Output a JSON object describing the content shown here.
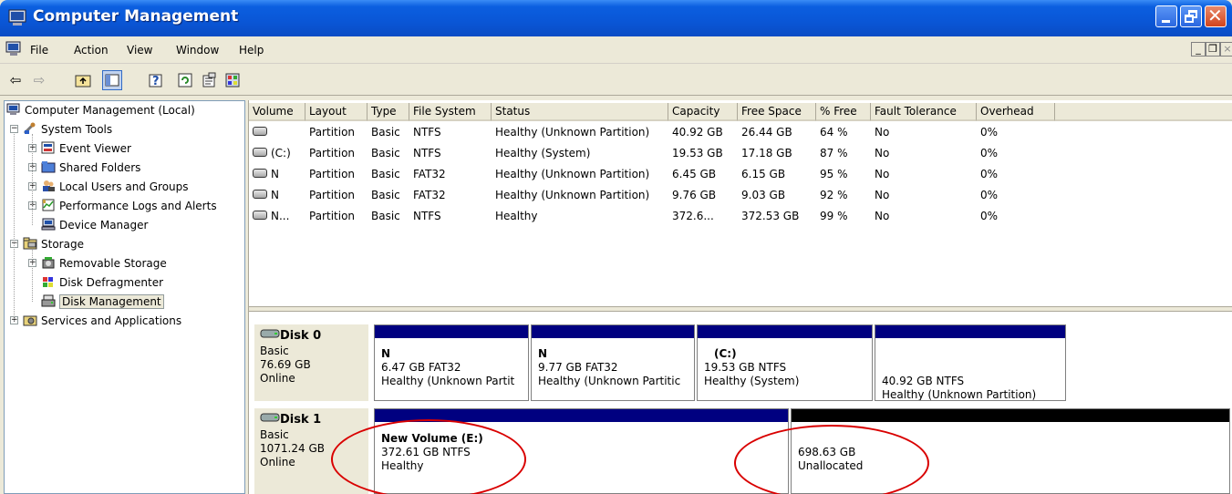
{
  "window": {
    "title": "Computer Management"
  },
  "menu": [
    "File",
    "Action",
    "View",
    "Window",
    "Help"
  ],
  "tree": {
    "root": "Computer Management (Local)",
    "items": [
      {
        "label": "System Tools",
        "level": 1
      },
      {
        "label": "Event Viewer",
        "level": 2
      },
      {
        "label": "Shared Folders",
        "level": 2
      },
      {
        "label": "Local Users and Groups",
        "level": 2
      },
      {
        "label": "Performance Logs and Alerts",
        "level": 2
      },
      {
        "label": "Device Manager",
        "level": 2
      },
      {
        "label": "Storage",
        "level": 1
      },
      {
        "label": "Removable Storage",
        "level": 2
      },
      {
        "label": "Disk Defragmenter",
        "level": 2
      },
      {
        "label": "Disk Management",
        "level": 2,
        "selected": true
      },
      {
        "label": "Services and Applications",
        "level": 1
      }
    ]
  },
  "volumes": {
    "columns": [
      "Volume",
      "Layout",
      "Type",
      "File System",
      "Status",
      "Capacity",
      "Free Space",
      "% Free",
      "Fault Tolerance",
      "Overhead"
    ],
    "rows": [
      [
        "",
        "Partition",
        "Basic",
        "NTFS",
        "Healthy (Unknown Partition)",
        "40.92 GB",
        "26.44 GB",
        "64 %",
        "No",
        "0%"
      ],
      [
        "(C:)",
        "Partition",
        "Basic",
        "NTFS",
        "Healthy (System)",
        "19.53 GB",
        "17.18 GB",
        "87 %",
        "No",
        "0%"
      ],
      [
        "N",
        "Partition",
        "Basic",
        "FAT32",
        "Healthy (Unknown Partition)",
        "6.45 GB",
        "6.15 GB",
        "95 %",
        "No",
        "0%"
      ],
      [
        "N",
        "Partition",
        "Basic",
        "FAT32",
        "Healthy (Unknown Partition)",
        "9.76 GB",
        "9.03 GB",
        "92 %",
        "No",
        "0%"
      ],
      [
        "N...",
        "Partition",
        "Basic",
        "NTFS",
        "Healthy",
        "372.6...",
        "372.53 GB",
        "99 %",
        "No",
        "0%"
      ]
    ]
  },
  "disks": [
    {
      "name": "Disk 0",
      "type": "Basic",
      "size": "76.69 GB",
      "state": "Online",
      "partitions": [
        {
          "name": "N",
          "line2": "6.47 GB FAT32",
          "line3": "Healthy (Unknown Partit"
        },
        {
          "name": "N",
          "line2": "9.77 GB FAT32",
          "line3": "Healthy (Unknown Partitic"
        },
        {
          "name": "(C:)",
          "line2": "19.53 GB NTFS",
          "line3": "Healthy (System)"
        },
        {
          "name": "",
          "line2": "40.92 GB NTFS",
          "line3": "Healthy (Unknown Partition)"
        }
      ]
    },
    {
      "name": "Disk 1",
      "type": "Basic",
      "size": "1071.24 GB",
      "state": "Online",
      "partitions": [
        {
          "name": "New Volume  (E:)",
          "line2": "372.61 GB NTFS",
          "line3": "Healthy"
        },
        {
          "name": "",
          "line2": "698.63 GB",
          "line3": "Unallocated"
        }
      ]
    }
  ]
}
